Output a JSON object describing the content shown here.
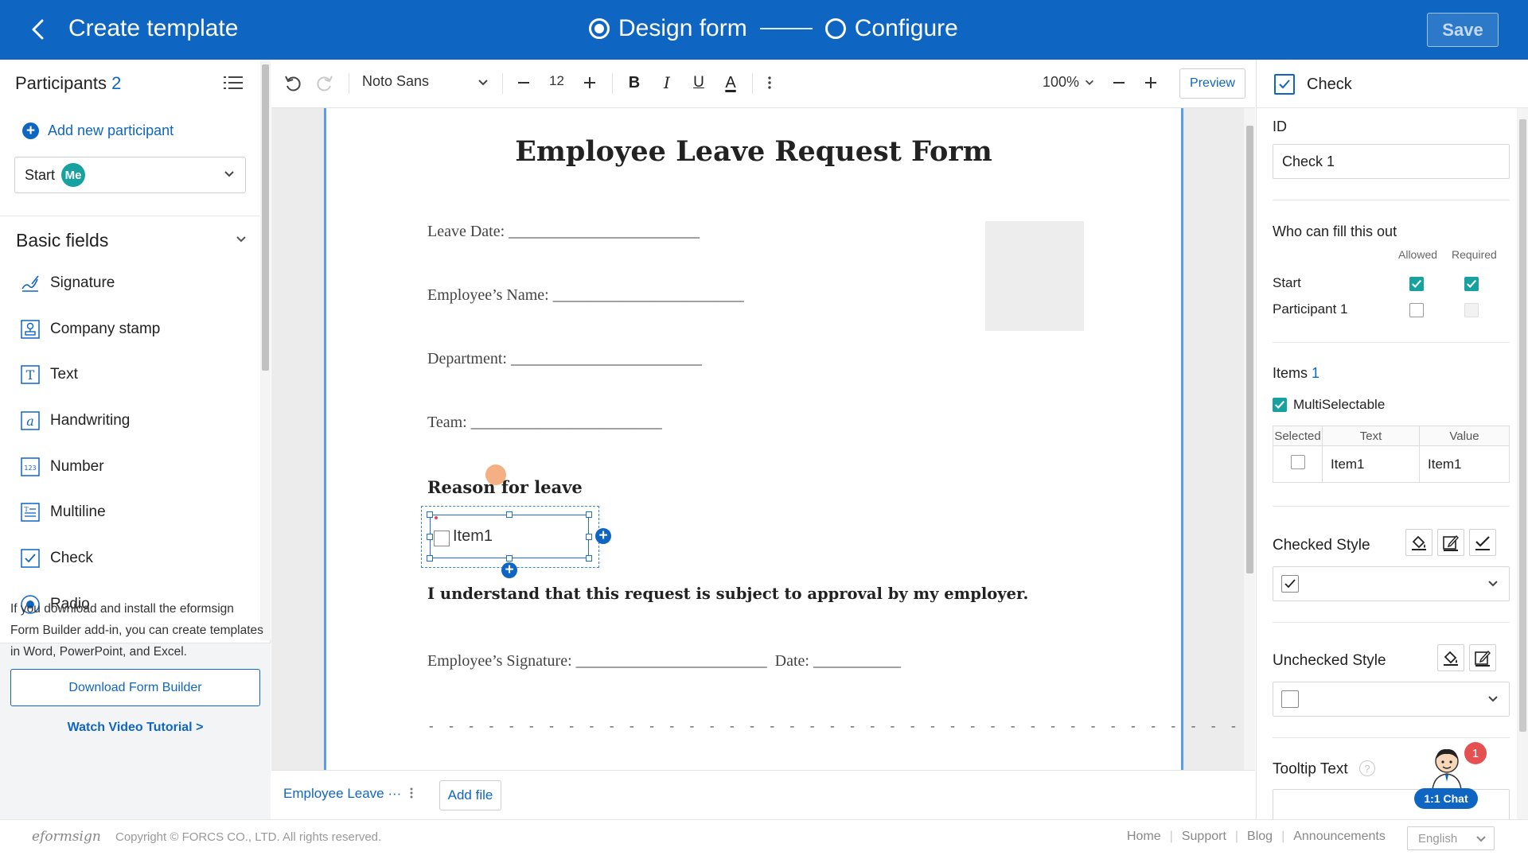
{
  "header": {
    "title": "Create template",
    "steps": [
      {
        "label": "Design form",
        "active": true
      },
      {
        "label": "Configure",
        "active": false
      }
    ],
    "save_label": "Save",
    "brand_color": "#0f66c2"
  },
  "left_panel": {
    "participants_title": "Participants",
    "participants_count": "2",
    "add_participant": "Add new participant",
    "participant_select": {
      "value": "Start",
      "badge": "Me"
    },
    "basic_fields_title": "Basic fields",
    "fields": [
      {
        "label": "Signature",
        "icon": "signature-icon"
      },
      {
        "label": "Company stamp",
        "icon": "stamp-icon"
      },
      {
        "label": "Text",
        "icon": "text-icon"
      },
      {
        "label": "Handwriting",
        "icon": "handwriting-icon"
      },
      {
        "label": "Number",
        "icon": "number-icon"
      },
      {
        "label": "Multiline",
        "icon": "multiline-icon"
      },
      {
        "label": "Check",
        "icon": "check-icon"
      },
      {
        "label": "Radio",
        "icon": "radio-icon"
      }
    ],
    "addin_text": "If you download and install the eformsign Form Builder add-in, you can create templates in Word, PowerPoint, and Excel.",
    "download_button": "Download Form Builder",
    "video_link": "Watch Video Tutorial >"
  },
  "toolbar": {
    "font_family": "Noto Sans",
    "font_size": "12",
    "bold": "B",
    "italic": "I",
    "underline": "U",
    "font_color": "A",
    "zoom": "100%",
    "preview": "Preview"
  },
  "document": {
    "title": "Employee Leave Request Form",
    "leave_date": "Leave Date: ________________________",
    "employee_name": "Employee’s Name: ________________________",
    "department": "Department: ________________________",
    "team": "Team: ________________________",
    "reason_heading": "Reason for leave",
    "check_item": "Item1",
    "approval_note": "I understand that this request is subject to approval by my employer.",
    "signature_line": "Employee’s Signature: ________________________  Date: ___________",
    "dashes": "- - - - - - - - - - - - - - - - - - - - - - - - - - - - - - - - - - - - - - - - - - - - - - - - - - - - - - - - - - - - - - - - - - -"
  },
  "bottom_tabs": {
    "doc_tab": "Employee Leave ···",
    "add_file": "Add file"
  },
  "right_panel": {
    "field_type": "Check",
    "id_label": "ID",
    "id_value": "Check 1",
    "who_label": "Who can fill this out",
    "allowed_label": "Allowed",
    "required_label": "Required",
    "permissions": [
      {
        "name": "Start",
        "allowed": true,
        "required": true
      },
      {
        "name": "Participant 1",
        "allowed": false,
        "required": false
      }
    ],
    "items_label": "Items",
    "items_count": "1",
    "multiselectable_label": "MultiSelectable",
    "table_headers": [
      "Selected",
      "Text",
      "Value"
    ],
    "table_rows": [
      {
        "text": "Item1",
        "value": "Item1"
      }
    ],
    "checked_style_label": "Checked Style",
    "unchecked_style_label": "Unchecked Style",
    "tooltip_label": "Tooltip Text",
    "chat_label": "1:1 Chat",
    "chat_badge": "1"
  },
  "footer": {
    "logo": "eformsign",
    "copyright": "Copyright © FORCS CO., LTD. All rights reserved.",
    "links": [
      "Home",
      "Support",
      "Blog",
      "Announcements"
    ],
    "language": "English"
  }
}
